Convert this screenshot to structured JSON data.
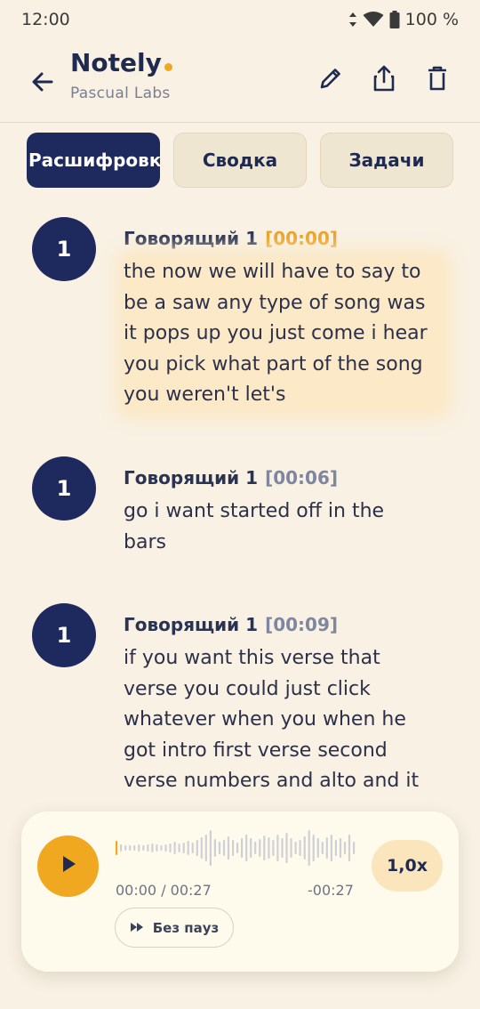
{
  "status_bar": {
    "time": "12:00",
    "battery": "100 %"
  },
  "app_bar": {
    "title": "Notely",
    "subtitle": "Pascual Labs",
    "accent_color": "#f0a820"
  },
  "tabs": [
    {
      "label": "Расшифровк",
      "active": true
    },
    {
      "label": "Сводка",
      "active": false
    },
    {
      "label": "Задачи",
      "active": false
    }
  ],
  "segments": [
    {
      "avatar": "1",
      "speaker": "Говорящий 1",
      "timestamp": "[00:00]",
      "current": true,
      "lines": [
        "the now we will have to say to",
        "be a saw any type of song was",
        "it pops up you just come i hear",
        "you pick what part of the song",
        "you weren't let's"
      ]
    },
    {
      "avatar": "1",
      "speaker": "Говорящий 1",
      "timestamp": "[00:06]",
      "current": false,
      "lines": [
        "go i want started off in the",
        "bars"
      ]
    },
    {
      "avatar": "1",
      "speaker": "Говорящий 1",
      "timestamp": "[00:09]",
      "current": false,
      "lines": [
        "if you want this verse that",
        "verse you could just click",
        "whatever when you when he",
        "got intro first verse second",
        "verse numbers and alto and it"
      ]
    }
  ],
  "player": {
    "position": "00:00 / 00:27",
    "remaining": "-00:27",
    "speed": "1,0x",
    "skip_silence_label": "Без пауз",
    "progress": 0.0
  }
}
